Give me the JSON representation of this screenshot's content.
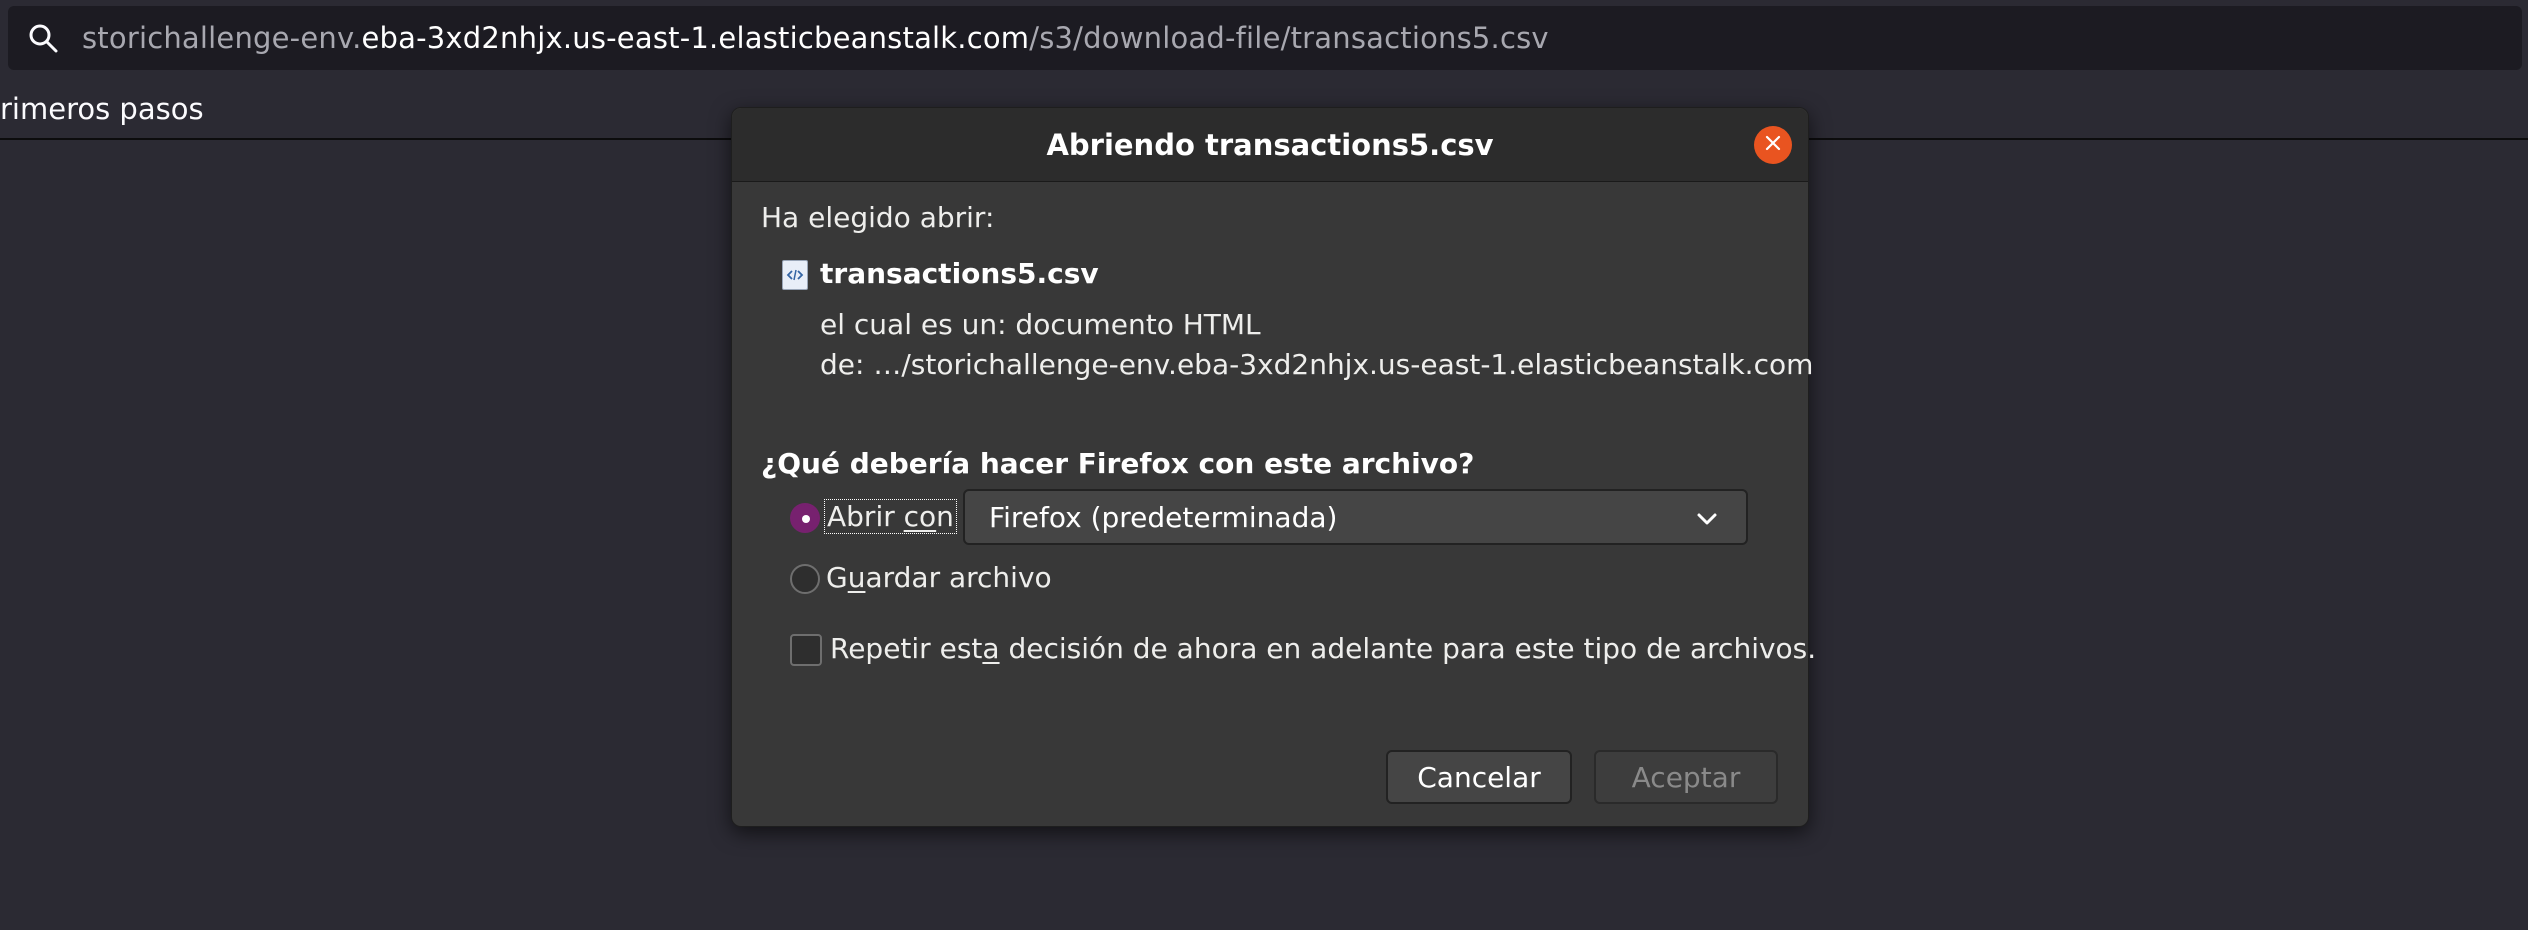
{
  "urlbar": {
    "url_prefix": "storichallenge-env.",
    "url_domain": "eba-3xd2nhjx.us-east-1.elasticbeanstalk.com",
    "url_path": "/s3/download-file/transactions5.csv"
  },
  "bookmarks": {
    "first_item": "rimeros pasos"
  },
  "dialog": {
    "title": "Abriendo transactions5.csv",
    "chosen_label": "Ha elegido abrir:",
    "file_name": "transactions5.csv",
    "file_type": "el cual es un: documento HTML",
    "file_from": "de: …/storichallenge-env.eba-3xd2nhjx.us-east-1.elasticbeanstalk.com",
    "question": "¿Qué debería hacer Firefox con este archivo?",
    "open_with": {
      "label_a": "Abrir ",
      "label_u": "co",
      "label_b": "n",
      "selected_app": "Firefox (predeterminada)",
      "checked": true
    },
    "save_file": {
      "label_a": "G",
      "label_u": "u",
      "label_b": "ardar archivo",
      "checked": false
    },
    "remember": {
      "label_a": "Repetir est",
      "label_u": "a",
      "label_b": " decisión de ahora en adelante para este tipo de archivos.",
      "checked": false
    },
    "cancel_label": "Cancelar",
    "accept_label": "Aceptar"
  },
  "colors": {
    "accent_radio": "#77216f",
    "close_button": "#e95420",
    "page_bg": "#2b2a33"
  }
}
